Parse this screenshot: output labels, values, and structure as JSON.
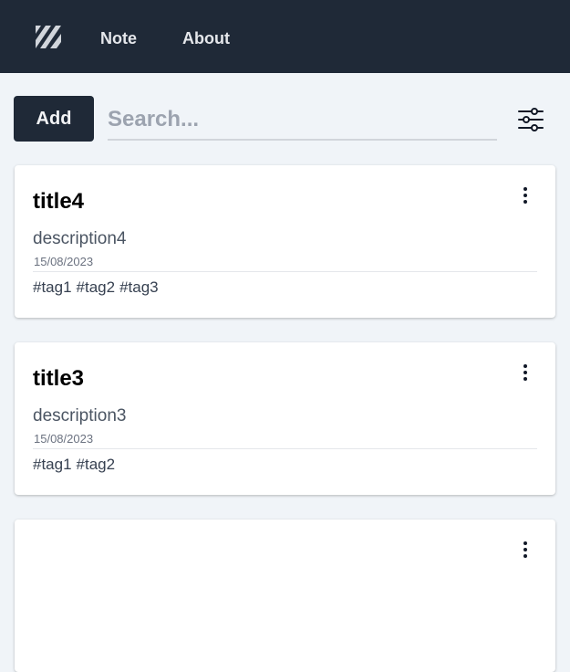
{
  "nav": {
    "logo_icon": "diagonal-stripes-logo-icon",
    "items": [
      {
        "label": "Note"
      },
      {
        "label": "About"
      }
    ]
  },
  "toolbar": {
    "add_label": "Add",
    "search_placeholder": "Search...",
    "search_value": "",
    "filter_icon": "sliders-icon"
  },
  "colors": {
    "topbar": "#1f2937",
    "background": "#f0f4f8",
    "card": "#ffffff"
  },
  "notes": [
    {
      "title": "title4",
      "description": "description4",
      "date": "15/08/2023",
      "tags": [
        "#tag1",
        "#tag2",
        "#tag3"
      ],
      "menu_icon": "more-vertical-icon"
    },
    {
      "title": "title3",
      "description": "description3",
      "date": "15/08/2023",
      "tags": [
        "#tag1",
        "#tag2"
      ],
      "menu_icon": "more-vertical-icon"
    }
  ]
}
